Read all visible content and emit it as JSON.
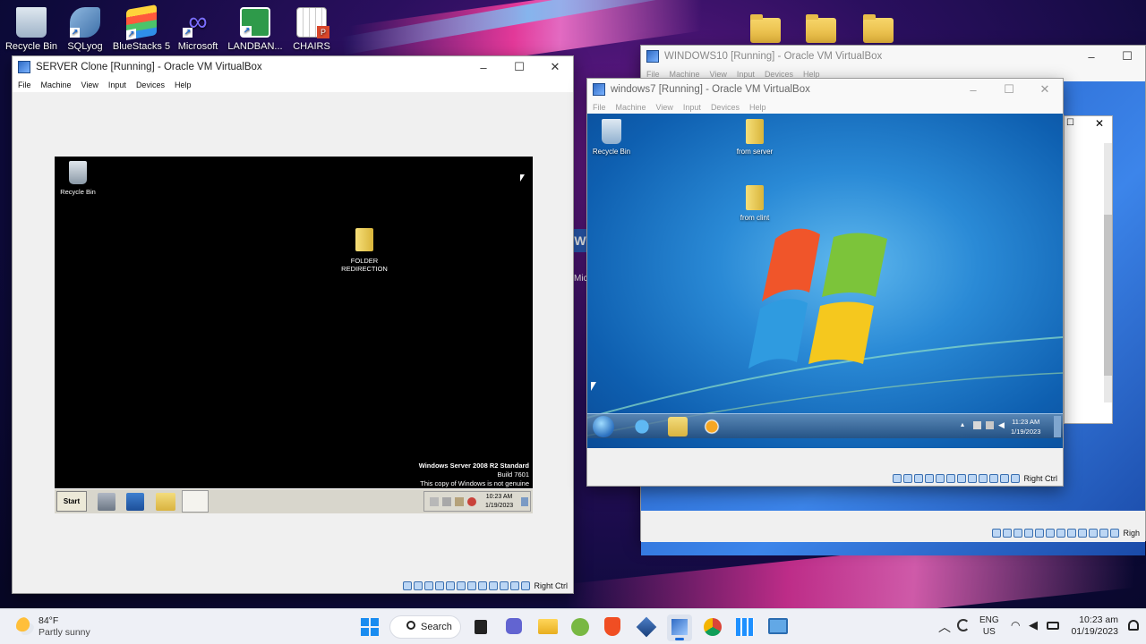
{
  "desktop_icons": [
    {
      "label": "Recycle Bin"
    },
    {
      "label": "SQLyog"
    },
    {
      "label": "BlueStacks 5"
    },
    {
      "label": "Microsoft"
    },
    {
      "label": "LANDBAN..."
    },
    {
      "label": "CHAIRS"
    }
  ],
  "server_window": {
    "title": "SERVER Clone [Running] - Oracle VM VirtualBox",
    "menu": [
      "File",
      "Machine",
      "View",
      "Input",
      "Devices",
      "Help"
    ],
    "vm": {
      "recycle_label": "Recycle Bin",
      "folder_label": "FOLDER REDIRECTION",
      "watermark_line1": "Windows Server 2008 R2 Standard",
      "watermark_line2": "Build 7601",
      "watermark_line3": "This copy of Windows is not genuine",
      "start_label": "Start",
      "time": "10:23 AM",
      "date": "1/19/2023"
    },
    "host_key": "Right Ctrl"
  },
  "win10_window": {
    "title": "WINDOWS10 [Running] - Oracle VM VirtualBox",
    "menu": [
      "File",
      "Machine",
      "View",
      "Input",
      "Devices",
      "Help"
    ],
    "host_key": "Righ"
  },
  "win7_window": {
    "title": "windows7 [Running] - Oracle VM VirtualBox",
    "menu": [
      "File",
      "Machine",
      "View",
      "Input",
      "Devices",
      "Help"
    ],
    "vm": {
      "recycle_label": "Recycle Bin",
      "folder1_label": "from server",
      "folder2_label": "from clint",
      "time": "11:23 AM",
      "date": "1/19/2023"
    },
    "host_key": "Right Ctrl"
  },
  "host_taskbar": {
    "weather_temp": "84°F",
    "weather_desc": "Partly sunny",
    "search_label": "Search",
    "lang_line1": "ENG",
    "lang_line2": "US",
    "time": "10:23 am",
    "date": "01/19/2023"
  }
}
